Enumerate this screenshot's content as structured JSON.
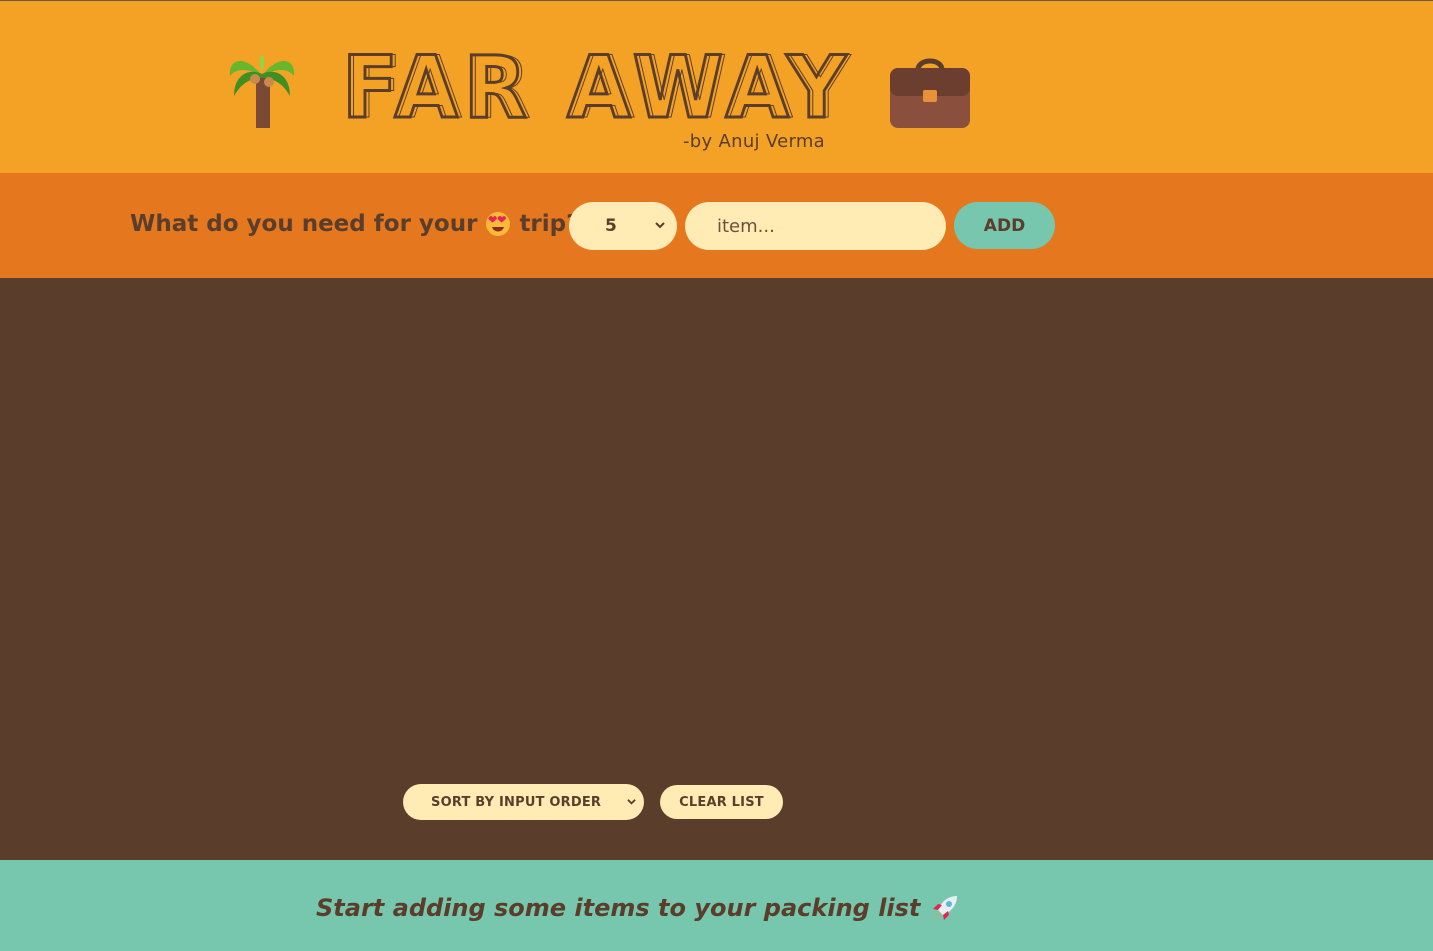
{
  "header": {
    "title": "FAR AWAY",
    "byline": "-by Anuj Verma",
    "left_icon": "palm-tree-icon",
    "right_icon": "briefcase-icon"
  },
  "form": {
    "question_prefix": "What do you need for your",
    "question_emoji": "heart-eyes-emoji",
    "question_suffix": "trip?",
    "quantity_value": "5",
    "item_placeholder": "item...",
    "add_label": "ADD"
  },
  "actions": {
    "sort_value": "SORT BY INPUT ORDER",
    "clear_label": "CLEAR LIST"
  },
  "footer": {
    "message": "Start adding some items to your packing list",
    "icon": "rocket-icon"
  },
  "colors": {
    "header_bg": "#f4a226",
    "form_bg": "#e5771e",
    "list_bg": "#5a3e2b",
    "footer_bg": "#76c7ad",
    "input_bg": "#ffebb3",
    "text": "#5a3e2b"
  }
}
